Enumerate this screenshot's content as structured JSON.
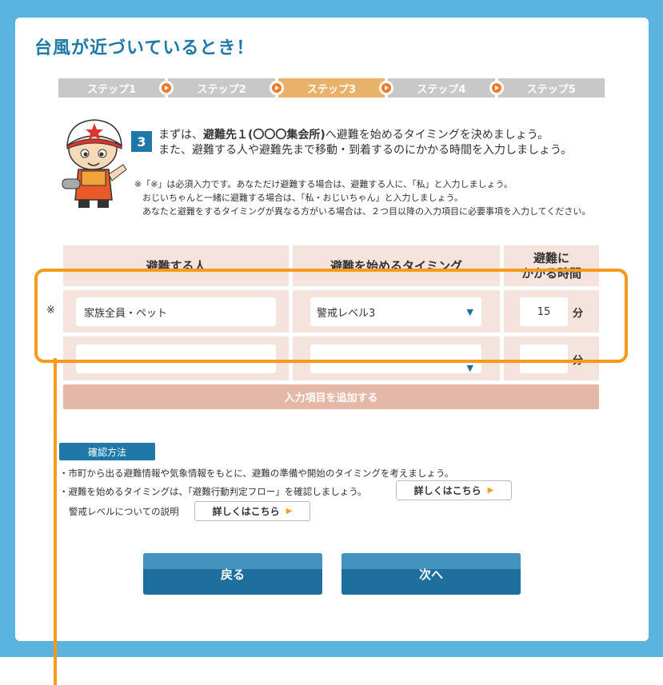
{
  "page": {
    "title": "台風が近づいているとき！"
  },
  "steps": [
    {
      "label": "ステップ1"
    },
    {
      "label": "ステップ2"
    },
    {
      "label": "ステップ3"
    },
    {
      "label": "ステップ4"
    },
    {
      "label": "ステップ5"
    }
  ],
  "active_step": 3,
  "intro": {
    "number": "3",
    "line1_pre": "まずは、",
    "line1_bold": "避難先１(〇〇〇集会所)",
    "line1_post": "へ避難を始めるタイミングを決めましょう。",
    "line2": "また、避難する人や避難先まで移動・到着するのにかかる時間を入力しましょう。"
  },
  "notes": [
    "※「※」は必須入力です。あなただけ避難する場合は、避難する人に、「私」と入力しましょう。",
    "おじいちゃんと一緒に避難する場合は、「私・おじいちゃん」と入力しましょう。",
    "あなたと避難をするタイミングが異なる方がいる場合は、２つ目以降の入力項目に必要事項を入力してください。"
  ],
  "table": {
    "headers": {
      "people": "避難する人",
      "timing": "避難を始めるタイミング",
      "time_line1": "避難に",
      "time_line2": "かかる時間"
    },
    "required_mark": "※",
    "unit": "分",
    "rows": [
      {
        "people": "家族全員・ペット",
        "timing": "警戒レベル3",
        "minutes": "15"
      },
      {
        "people": "",
        "timing": "",
        "minutes": ""
      }
    ],
    "add_label": "入力項目を追加する"
  },
  "confirm": {
    "tag": "確認方法",
    "line1": "・市町から出る避難情報や気象情報をもとに、避難の準備や開始のタイミングを考えましょう。",
    "line2": "・避難を始めるタイミングは、「避難行動判定フロー」を確認しましょう。",
    "line3": "警戒レベルについての説明",
    "detail_label": "詳しくはこちら"
  },
  "nav": {
    "back": "戻る",
    "next": "次へ"
  },
  "colors": {
    "brand": "#1f78a8",
    "accent": "#f59a1b",
    "step_active": "#e9b26b",
    "table_bg": "#f5e3dd"
  },
  "icons": {
    "step_arrow": "play-circle-icon",
    "select": "triangle-down-icon",
    "link_arrow": "triangle-right-icon"
  }
}
